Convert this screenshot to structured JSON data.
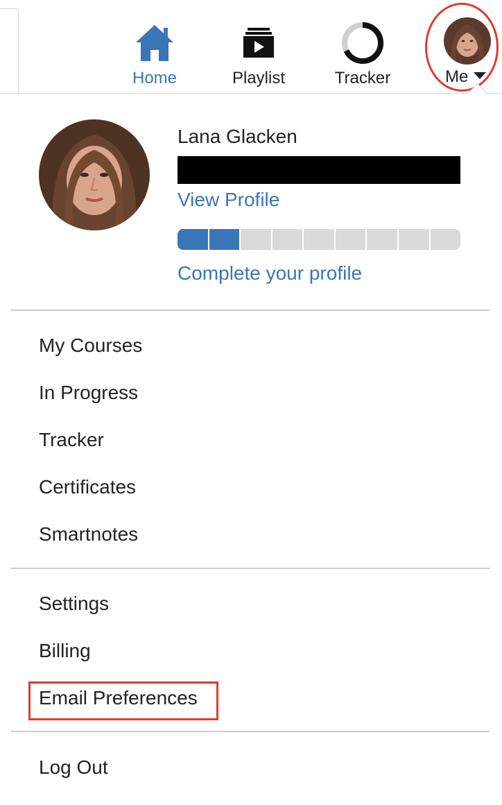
{
  "nav": {
    "home": {
      "label": "Home",
      "icon": "home-icon",
      "active": true
    },
    "playlist": {
      "label": "Playlist",
      "icon": "playlist-icon"
    },
    "tracker": {
      "label": "Tracker",
      "icon": "tracker-ring-icon"
    },
    "me": {
      "label": "Me",
      "icon": "chevron-down-icon"
    }
  },
  "profile": {
    "name": "Lana Glacken",
    "view_profile": "View Profile",
    "complete_profile": "Complete your profile",
    "progress_segments_filled": 2,
    "progress_segments_total": 9
  },
  "menu": {
    "group1": [
      "My Courses",
      "In Progress",
      "Tracker",
      "Certificates",
      "Smartnotes"
    ],
    "group2": [
      "Settings",
      "Billing",
      "Email Preferences"
    ],
    "group3": [
      "Log Out"
    ]
  },
  "colors": {
    "accent": "#3a75b8",
    "highlight": "#e23a2b",
    "divider": "#c9c9c9"
  }
}
